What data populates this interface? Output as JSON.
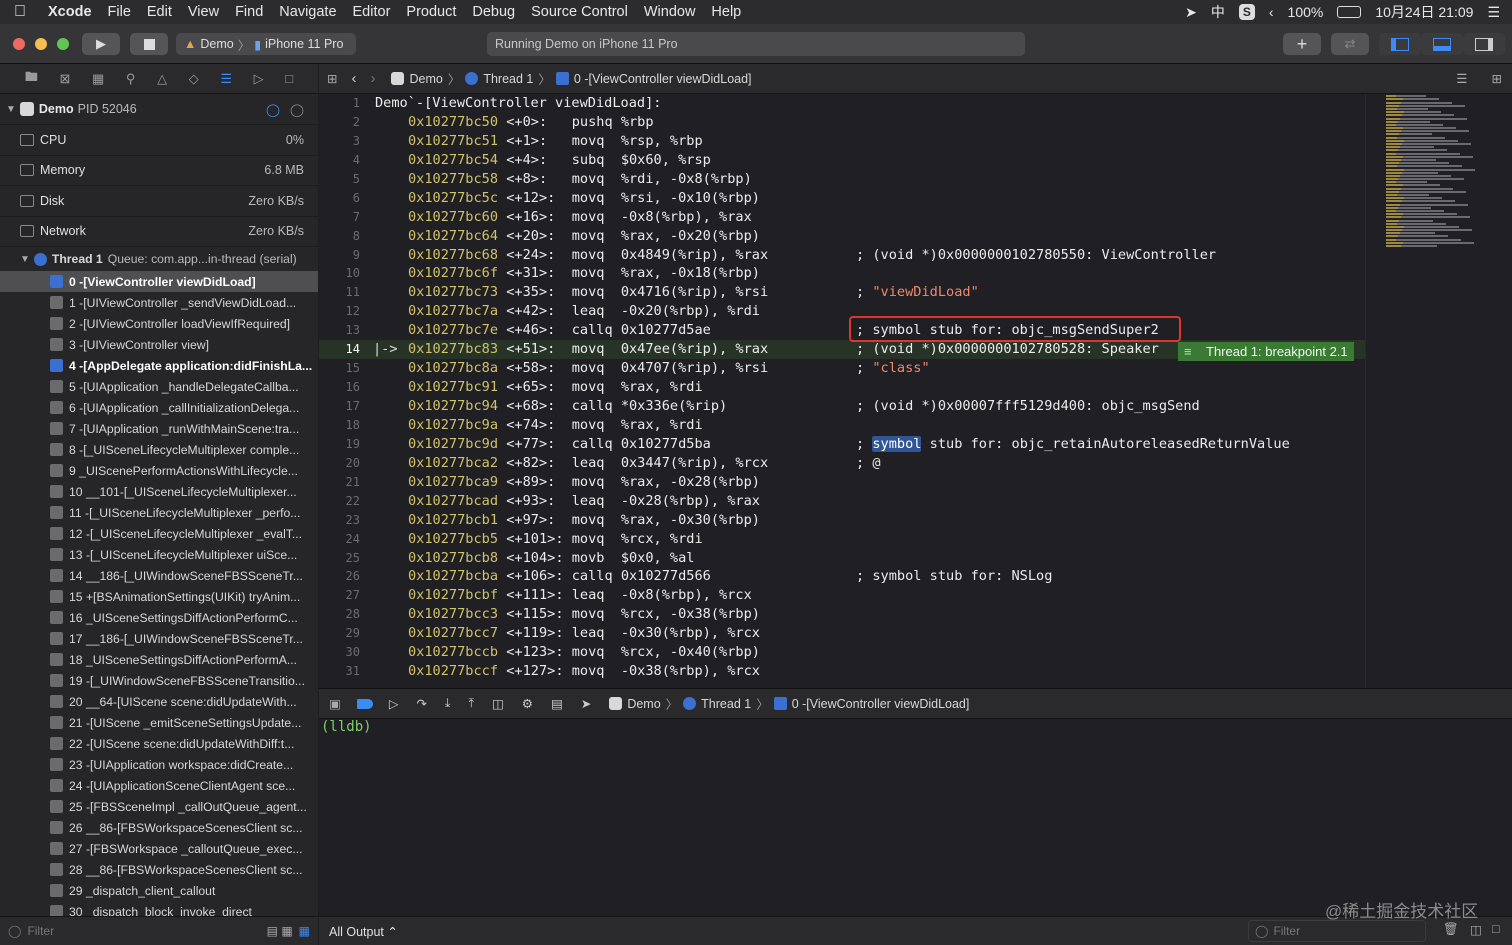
{
  "menubar": {
    "app": "Xcode",
    "items": [
      "File",
      "Edit",
      "View",
      "Find",
      "Navigate",
      "Editor",
      "Product",
      "Debug",
      "Source Control",
      "Window",
      "Help"
    ],
    "input_method": "中",
    "battery": "100%",
    "datetime": "10月24日 21:09"
  },
  "toolbar": {
    "scheme": "Demo",
    "device": "iPhone 11 Pro",
    "status": "Running Demo on iPhone 11 Pro"
  },
  "navigator": {
    "process": "Demo",
    "pid": "PID 52046",
    "gauges": [
      {
        "label": "CPU",
        "value": "0%"
      },
      {
        "label": "Memory",
        "value": "6.8 MB"
      },
      {
        "label": "Disk",
        "value": "Zero KB/s"
      },
      {
        "label": "Network",
        "value": "Zero KB/s"
      }
    ],
    "thread": "Thread 1",
    "queue": "Queue: com.app...in-thread (serial)",
    "frames": [
      "0 -[ViewController viewDidLoad]",
      "1 -[UIViewController _sendViewDidLoad...",
      "2 -[UIViewController loadViewIfRequired]",
      "3 -[UIViewController view]",
      "4 -[AppDelegate application:didFinishLa...",
      "5 -[UIApplication _handleDelegateCallba...",
      "6 -[UIApplication _callInitializationDelega...",
      "7 -[UIApplication _runWithMainScene:tra...",
      "8 -[_UISceneLifecycleMultiplexer comple...",
      "9 _UIScenePerformActionsWithLifecycle...",
      "10 __101-[_UISceneLifecycleMultiplexer...",
      "11 -[_UISceneLifecycleMultiplexer _perfo...",
      "12 -[_UISceneLifecycleMultiplexer _evalT...",
      "13 -[_UISceneLifecycleMultiplexer uiSce...",
      "14 __186-[_UIWindowSceneFBSSceneTr...",
      "15 +[BSAnimationSettings(UIKit) tryAnim...",
      "16 _UISceneSettingsDiffActionPerformC...",
      "17 __186-[_UIWindowSceneFBSSceneTr...",
      "18 _UISceneSettingsDiffActionPerformA...",
      "19 -[_UIWindowSceneFBSSceneTransitio...",
      "20 __64-[UIScene scene:didUpdateWith...",
      "21 -[UIScene _emitSceneSettingsUpdate...",
      "22 -[UIScene scene:didUpdateWithDiff:t...",
      "23 -[UIApplication workspace:didCreate...",
      "24 -[UIApplicationSceneClientAgent sce...",
      "25 -[FBSSceneImpl _callOutQueue_agent...",
      "26 __86-[FBSWorkspaceScenesClient sc...",
      "27 -[FBSWorkspace _calloutQueue_exec...",
      "28 __86-[FBSWorkspaceScenesClient sc...",
      "29 _dispatch_client_callout",
      "30 _dispatch_block_invoke_direct"
    ],
    "filter_placeholder": "Filter"
  },
  "jumpbar": {
    "project": "Demo",
    "thread": "Thread 1",
    "frame": "0 -[ViewController viewDidLoad]"
  },
  "editor": {
    "lines": [
      {
        "n": "1",
        "addr": "",
        "off": "",
        "mn": "",
        "ops": "Demo`-[ViewController viewDidLoad]:",
        "cm": ""
      },
      {
        "n": "2",
        "addr": "0x10277bc50",
        "off": "<+0>:  ",
        "mn": "pushq",
        "ops": "%rbp",
        "cm": ""
      },
      {
        "n": "3",
        "addr": "0x10277bc51",
        "off": "<+1>:  ",
        "mn": "movq ",
        "ops": "%rsp, %rbp",
        "cm": ""
      },
      {
        "n": "4",
        "addr": "0x10277bc54",
        "off": "<+4>:  ",
        "mn": "subq ",
        "ops": "$0x60, %rsp",
        "cm": ""
      },
      {
        "n": "5",
        "addr": "0x10277bc58",
        "off": "<+8>:  ",
        "mn": "movq ",
        "ops": "%rdi, -0x8(%rbp)",
        "cm": ""
      },
      {
        "n": "6",
        "addr": "0x10277bc5c",
        "off": "<+12>: ",
        "mn": "movq ",
        "ops": "%rsi, -0x10(%rbp)",
        "cm": ""
      },
      {
        "n": "7",
        "addr": "0x10277bc60",
        "off": "<+16>: ",
        "mn": "movq ",
        "ops": "-0x8(%rbp), %rax",
        "cm": ""
      },
      {
        "n": "8",
        "addr": "0x10277bc64",
        "off": "<+20>: ",
        "mn": "movq ",
        "ops": "%rax, -0x20(%rbp)",
        "cm": ""
      },
      {
        "n": "9",
        "addr": "0x10277bc68",
        "off": "<+24>: ",
        "mn": "movq ",
        "ops": "0x4849(%rip), %rax",
        "cm": "; (void *)0x0000000102780550: ViewController"
      },
      {
        "n": "10",
        "addr": "0x10277bc6f",
        "off": "<+31>: ",
        "mn": "movq ",
        "ops": "%rax, -0x18(%rbp)",
        "cm": ""
      },
      {
        "n": "11",
        "addr": "0x10277bc73",
        "off": "<+35>: ",
        "mn": "movq ",
        "ops": "0x4716(%rip), %rsi",
        "cm": "; ",
        "str": "\"viewDidLoad\""
      },
      {
        "n": "12",
        "addr": "0x10277bc7a",
        "off": "<+42>: ",
        "mn": "leaq ",
        "ops": "-0x20(%rbp), %rdi",
        "cm": ""
      },
      {
        "n": "13",
        "addr": "0x10277bc7e",
        "off": "<+46>: ",
        "mn": "callq",
        "ops": "0x10277d5ae",
        "cm": "; symbol stub for: objc_msgSendSuper2"
      },
      {
        "n": "14",
        "addr": "0x10277bc83",
        "off": "<+51>: ",
        "mn": "movq ",
        "ops": "0x47ee(%rip), %rax",
        "cm": "; (void *)0x0000000102780528: Speaker"
      },
      {
        "n": "15",
        "addr": "0x10277bc8a",
        "off": "<+58>: ",
        "mn": "movq ",
        "ops": "0x4707(%rip), %rsi",
        "cm": "; ",
        "str": "\"class\""
      },
      {
        "n": "16",
        "addr": "0x10277bc91",
        "off": "<+65>: ",
        "mn": "movq ",
        "ops": "%rax, %rdi",
        "cm": ""
      },
      {
        "n": "17",
        "addr": "0x10277bc94",
        "off": "<+68>: ",
        "mn": "callq",
        "ops": "*0x336e(%rip)",
        "cm": "; (void *)0x00007fff5129d400: objc_msgSend"
      },
      {
        "n": "18",
        "addr": "0x10277bc9a",
        "off": "<+74>: ",
        "mn": "movq ",
        "ops": "%rax, %rdi",
        "cm": ""
      },
      {
        "n": "19",
        "addr": "0x10277bc9d",
        "off": "<+77>: ",
        "mn": "callq",
        "ops": "0x10277d5ba",
        "cm": "; ",
        "sel": "symbol",
        "cmrest": " stub for: objc_retainAutoreleasedReturnValue"
      },
      {
        "n": "20",
        "addr": "0x10277bca2",
        "off": "<+82>: ",
        "mn": "leaq ",
        "ops": "0x3447(%rip), %rcx",
        "cm": "; @"
      },
      {
        "n": "21",
        "addr": "0x10277bca9",
        "off": "<+89>: ",
        "mn": "movq ",
        "ops": "%rax, -0x28(%rbp)",
        "cm": ""
      },
      {
        "n": "22",
        "addr": "0x10277bcad",
        "off": "<+93>: ",
        "mn": "leaq ",
        "ops": "-0x28(%rbp), %rax",
        "cm": ""
      },
      {
        "n": "23",
        "addr": "0x10277bcb1",
        "off": "<+97>: ",
        "mn": "movq ",
        "ops": "%rax, -0x30(%rbp)",
        "cm": ""
      },
      {
        "n": "24",
        "addr": "0x10277bcb5",
        "off": "<+101>:",
        "mn": "movq ",
        "ops": "%rcx, %rdi",
        "cm": ""
      },
      {
        "n": "25",
        "addr": "0x10277bcb8",
        "off": "<+104>:",
        "mn": "movb ",
        "ops": "$0x0, %al",
        "cm": ""
      },
      {
        "n": "26",
        "addr": "0x10277bcba",
        "off": "<+106>:",
        "mn": "callq",
        "ops": "0x10277d566",
        "cm": "; symbol stub for: NSLog"
      },
      {
        "n": "27",
        "addr": "0x10277bcbf",
        "off": "<+111>:",
        "mn": "leaq ",
        "ops": "-0x8(%rbp), %rcx",
        "cm": ""
      },
      {
        "n": "28",
        "addr": "0x10277bcc3",
        "off": "<+115>:",
        "mn": "movq ",
        "ops": "%rcx, -0x38(%rbp)",
        "cm": ""
      },
      {
        "n": "29",
        "addr": "0x10277bcc7",
        "off": "<+119>:",
        "mn": "leaq ",
        "ops": "-0x30(%rbp), %rcx",
        "cm": ""
      },
      {
        "n": "30",
        "addr": "0x10277bccb",
        "off": "<+123>:",
        "mn": "movq ",
        "ops": "%rcx, -0x40(%rbp)",
        "cm": ""
      },
      {
        "n": "31",
        "addr": "0x10277bccf",
        "off": "<+127>:",
        "mn": "movq ",
        "ops": "-0x38(%rbp), %rcx",
        "cm": ""
      }
    ],
    "breakpoint_line": "14",
    "breakpoint_badge": "Thread 1: breakpoint 2.1",
    "pc_marker": "|->"
  },
  "debugbar": {
    "project": "Demo",
    "thread": "Thread 1",
    "frame": "0 -[ViewController viewDidLoad]"
  },
  "console": {
    "prompt": "(lldb)",
    "output_selector": "All Output ⌃",
    "filter_placeholder": "Filter"
  },
  "watermark": "@稀土掘金技术社区",
  "colors": {
    "accent": "#3d8bf5",
    "breakpoint": "#3a7a35",
    "highlight_box": "#e0352f",
    "address": "#d0c36a",
    "string": "#f08a6c"
  }
}
